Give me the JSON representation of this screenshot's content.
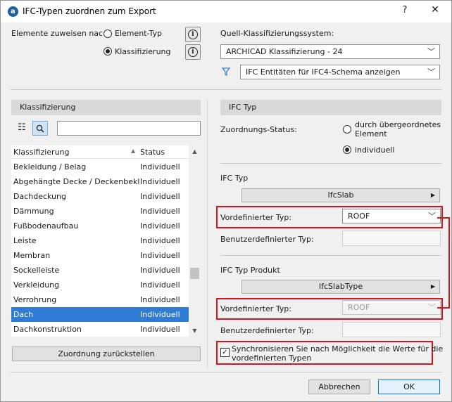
{
  "window": {
    "title": "IFC-Typen zuordnen zum Export",
    "help": "?",
    "close": "✕"
  },
  "assign": {
    "label": "Elemente zuweisen nac",
    "options": [
      "Element-Typ",
      "Klassifizierung"
    ],
    "selected": "Klassifizierung"
  },
  "source": {
    "label": "Quell-Klassifizierungssystem:",
    "value": "ARCHICAD Klassifizierung - 24",
    "filter_value": "IFC Entitäten für IFC4-Schema anzeigen"
  },
  "left_panel": {
    "header": "Klassifizierung",
    "search_value": "",
    "columns": [
      "Klassifizierung",
      "Status"
    ],
    "rows": [
      {
        "name": "Bekleidung / Belag",
        "status": "Individuell"
      },
      {
        "name": "Abgehängte Decke / Deckenbekl...",
        "status": "Individuell"
      },
      {
        "name": "Dachdeckung",
        "status": "Individuell"
      },
      {
        "name": "Dämmung",
        "status": "Individuell"
      },
      {
        "name": "Fußbodenaufbau",
        "status": "Individuell"
      },
      {
        "name": "Leiste",
        "status": "Individuell"
      },
      {
        "name": "Membran",
        "status": "Individuell"
      },
      {
        "name": "Sockelleiste",
        "status": "Individuell"
      },
      {
        "name": "Verkleidung",
        "status": "Individuell"
      },
      {
        "name": "Verrohrung",
        "status": "Individuell"
      },
      {
        "name": "Dach",
        "status": "Individuell"
      },
      {
        "name": "Dachkonstruktion",
        "status": "Individuell"
      }
    ],
    "selected_row": "Dach",
    "reset_button": "Zuordnung zurückstellen"
  },
  "right_panel": {
    "header": "IFC Typ",
    "mapping_status_label": "Zuordnungs-Status:",
    "status_options": [
      "durch übergeordnetes Element",
      "individuell"
    ],
    "status_option_1_line1": "durch übergeordnetes",
    "status_option_1_line2": "Element",
    "status_selected": "individuell",
    "ifc_type": {
      "label": "IFC Typ",
      "value": "IfcSlab",
      "predefined_label": "Vordefinierter Typ:",
      "predefined_value": "ROOF",
      "user_defined_label": "Benutzerdefinierter Typ:",
      "user_defined_value": ""
    },
    "ifc_type_product": {
      "label": "IFC Typ Produkt",
      "value": "IfcSlabType",
      "predefined_label": "Vordefinierter Typ:",
      "predefined_value": "ROOF",
      "user_defined_label": "Benutzerdefinierter Typ:",
      "user_defined_value": ""
    },
    "sync_checkbox": {
      "checked": true,
      "label_line1": "Synchronisieren Sie nach Möglichkeit die Werte für die",
      "label_line2": "vordefinierten Typen"
    }
  },
  "footer": {
    "cancel": "Abbrechen",
    "ok": "OK"
  },
  "colors": {
    "highlight": "#d9141b",
    "selection": "#2f7bd6",
    "filter_icon": "#2f7bd6"
  }
}
